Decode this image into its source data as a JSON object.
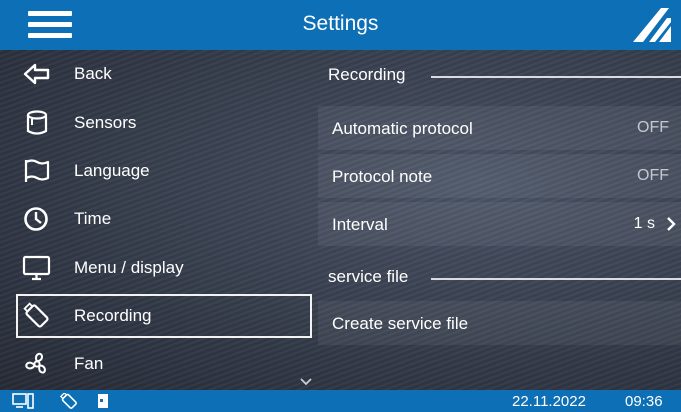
{
  "header": {
    "title": "Settings",
    "menu_icon": "hamburger-icon",
    "logo_icon": "brand-logo-icon"
  },
  "sidebar": {
    "items": [
      {
        "label": "Back",
        "icon": "back-arrow-icon"
      },
      {
        "label": "Sensors",
        "icon": "sensor-cylinder-icon"
      },
      {
        "label": "Language",
        "icon": "flag-icon"
      },
      {
        "label": "Time",
        "icon": "clock-icon"
      },
      {
        "label": "Menu / display",
        "icon": "monitor-icon"
      },
      {
        "label": "Recording",
        "icon": "usb-stick-icon",
        "selected": true
      },
      {
        "label": "Fan",
        "icon": "fan-icon"
      }
    ]
  },
  "panel": {
    "sections": [
      {
        "title": "Recording",
        "rows": [
          {
            "label": "Automatic protocol",
            "value": "OFF"
          },
          {
            "label": "Protocol note",
            "value": "OFF"
          },
          {
            "label": "Interval",
            "value": "1 s"
          }
        ]
      },
      {
        "title": "service file",
        "rows": [
          {
            "label": "Create service file",
            "value": ""
          }
        ]
      }
    ]
  },
  "status": {
    "icons": [
      "pc-connection-icon",
      "usb-stick-icon",
      "sd-card-icon"
    ],
    "date": "22.11.2022",
    "time": "09:36"
  },
  "colors": {
    "accent": "#0d6fb5",
    "text": "#ffffff",
    "value_off": "#c4c8d0"
  }
}
